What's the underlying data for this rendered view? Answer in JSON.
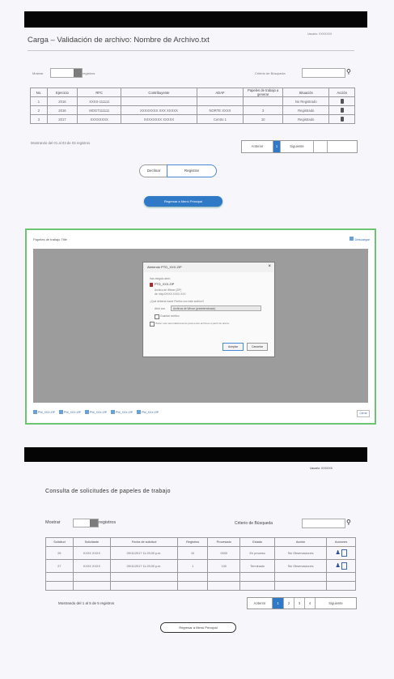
{
  "top_bar_1": {
    "user_label": "Usuario: XXXXXXX"
  },
  "carga": {
    "title": "Carga – Validación de archivo: Nombre de Archivo.txt",
    "mostrar_label": "Mostrar",
    "registros_label": "registros",
    "criterio_label": "Criterio de Búsqueda",
    "columns": [
      "No.",
      "Ejercicio",
      "RFC",
      "Contribuyente",
      "ADAF",
      "Papeles de trabajo a generar",
      "Situación",
      "Acción"
    ],
    "rows": [
      [
        "1",
        "2016",
        "XXXX-111111",
        "",
        "",
        "",
        "No Registrado",
        ""
      ],
      [
        "2",
        "2016",
        "MOGT111111",
        "XXXXXXXX XXX XXXXX",
        "NORTE XXXX",
        "3",
        "Registrado",
        ""
      ],
      [
        "3",
        "2017",
        "XXXXXXXX",
        "XXXXXXXX XXXXX",
        "Centro 1",
        "10",
        "Registrado",
        ""
      ]
    ],
    "showing": "Mostrando del 01 al 03 de 03 registros",
    "pager": [
      "Anterior",
      "1",
      "Siguiente"
    ],
    "buttons": {
      "decline": "Declinar",
      "register": "Registrar",
      "return": "Regresar a Menú Principal"
    }
  },
  "browser": {
    "title": "Papeles de trabajo Title",
    "top_right": "Descargar",
    "downloads": [
      "PW_XXX.ZIP",
      "PW_XXX.ZIP",
      "PW_XXX.ZIP",
      "PW_XXX.ZIP",
      "PW_XXX.ZIP"
    ],
    "bottom_right": "Cerrar",
    "dialog": {
      "title": "Abriendo PTD_XXX.ZIP",
      "intro": "Has elegido abrir:",
      "filename": "PTD_XXX.ZIP",
      "filetype": "Archivo de Winrar (ZIP)",
      "from": "de: http://XXXX.XXXX.XXX",
      "question": "¿Qué debería hacer Firefox con este archivo?",
      "open_with_label": "Abrir con",
      "open_with_value": "Archivos de Winrar (predeterminado)",
      "save_label": "Guardar archivo",
      "remember_label": "Hacer esto automáticamente para estos archivos a partir de ahora.",
      "accept": "Aceptar",
      "cancel": "Cancelar"
    }
  },
  "top_bar_2": {
    "user_label": "Usuario: XXXXXX"
  },
  "consulta": {
    "title": "Consulta de solicitudes de papeles de trabajo",
    "mostrar_label": "Mostrar",
    "registros_label": "registros",
    "criterio_label": "Criterio de Búsqueda",
    "columns": [
      "Solicitud",
      "Solicitante",
      "Fecha de solicitud",
      "Registros",
      "Procesado",
      "Estado",
      "Acción",
      "Acciones"
    ],
    "rows": [
      [
        "26",
        "XXXX XXXX",
        "09/11/2017 11:23:00 p.m.",
        "10",
        "0000",
        "En proceso",
        "Sin Observaciones",
        ""
      ],
      [
        "27",
        "XXXX XXXX",
        "09/11/2017 11:23:00 p.m.",
        "1",
        "100",
        "Terminado",
        "Sin Observaciones",
        ""
      ],
      [
        "",
        "",
        "",
        "",
        "",
        "",
        "",
        ""
      ],
      [
        "",
        "",
        "",
        "",
        "",
        "",
        "",
        ""
      ]
    ],
    "showing": "Mostrando del 1 al 5 de 5 registros",
    "pager": [
      "Anterior",
      "1",
      "2",
      "3",
      "4",
      "Siguiente"
    ],
    "return_button": "Regresar a Menú Principal"
  }
}
